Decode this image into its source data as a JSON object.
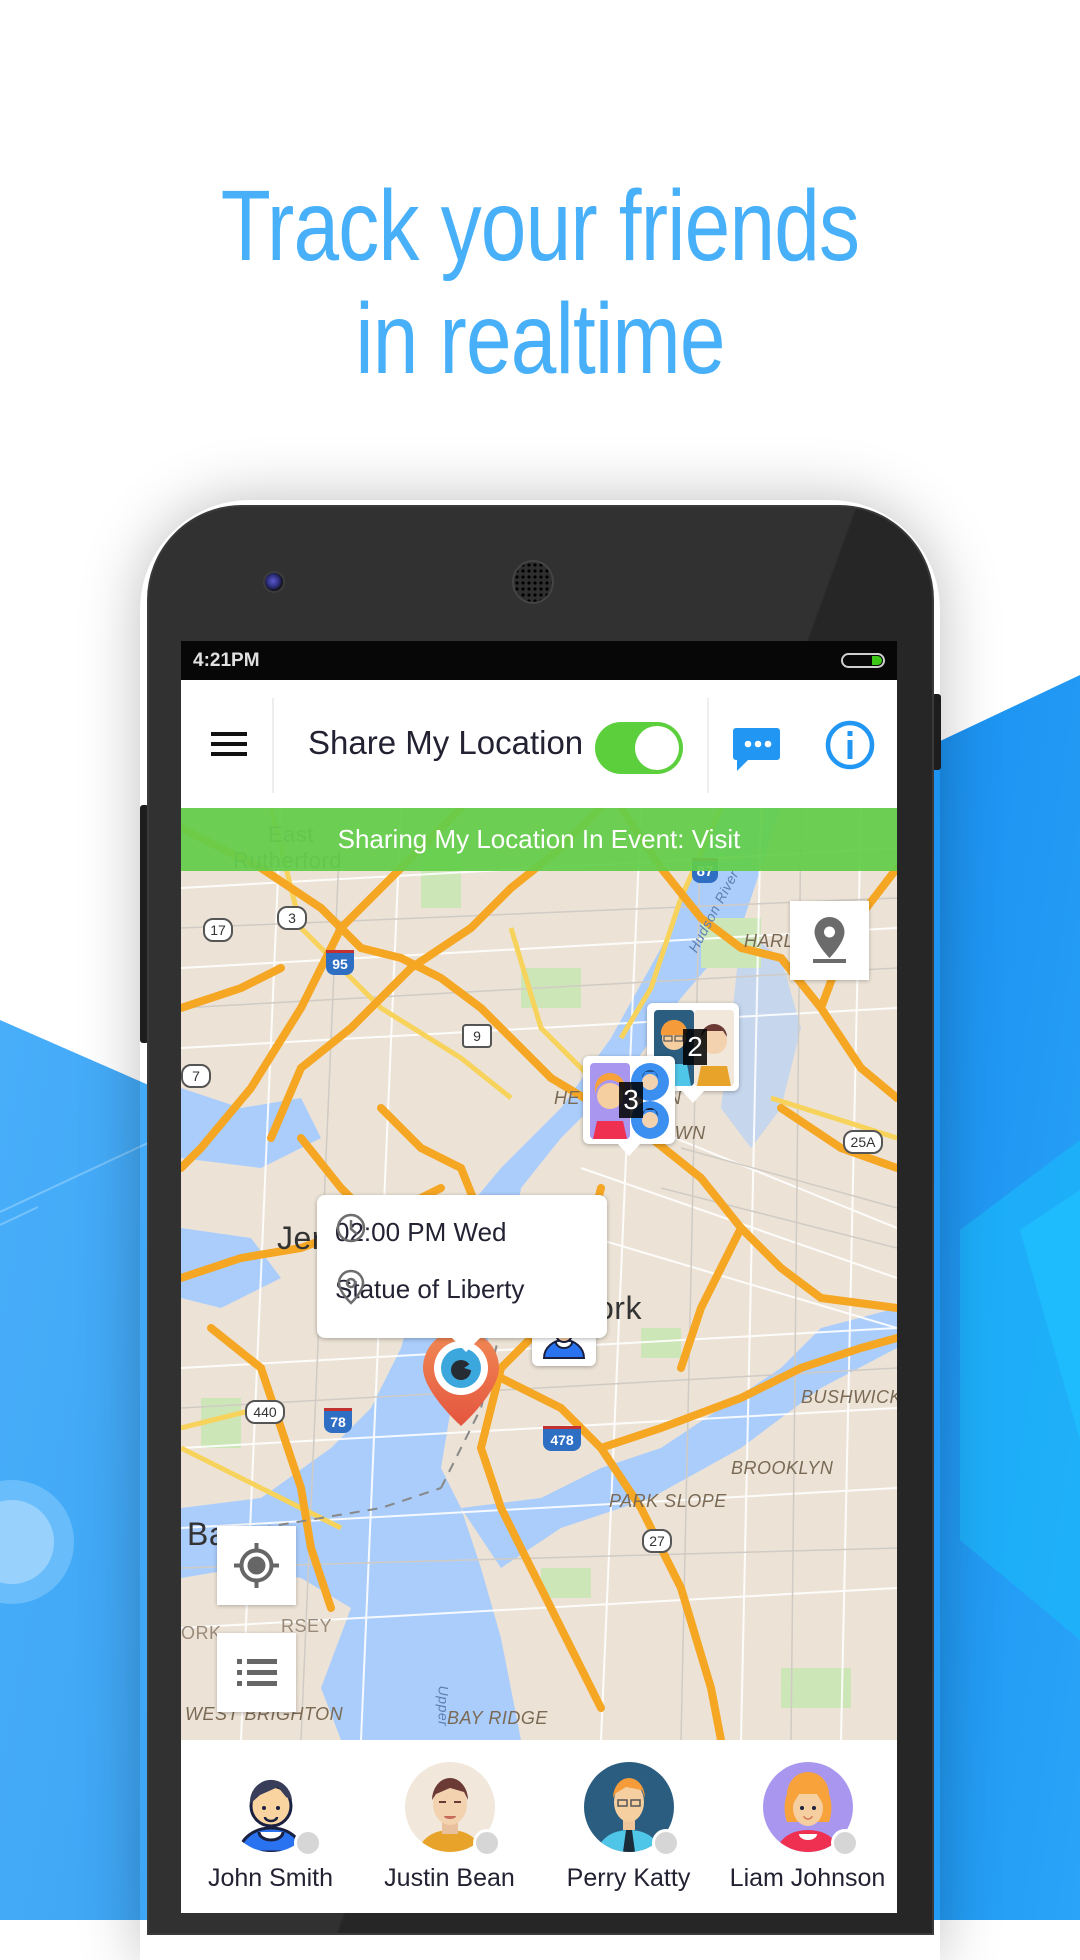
{
  "headline": {
    "line1": "Track your friends",
    "line2": "in realtime"
  },
  "colors": {
    "headline": "#48b0f8",
    "accent_blue": "#2196f3",
    "toggle_on": "#5ccf3c",
    "banner_green": "#62ce4a",
    "map_land": "#ece3d6",
    "map_water": "#abcdfb",
    "highway": "#f5a623"
  },
  "status_bar": {
    "time": "4:21PM",
    "battery_icon": "battery-icon"
  },
  "app_bar": {
    "menu_icon": "hamburger-menu-icon",
    "share_label": "Share My Location",
    "share_toggle_on": true,
    "chat_icon": "chat-bubble-icon",
    "info_icon": "info-icon"
  },
  "banner": {
    "text": "Sharing My Location In Event: Visit"
  },
  "map": {
    "labels": {
      "east_rutherford_1": "East",
      "east_rutherford_2": "Rutherford",
      "harlem": "HARLE",
      "hudson": "Hudson River",
      "hells_kitchen": "HE                N",
      "midtown": "MI    TOWN",
      "jersey": "Jer",
      "newyork_n": "N",
      "newyork_ork": "ork",
      "bushwick": "BUSHWICK",
      "brooklyn": "BROOKLYN",
      "park_slope": "PARK SLOPE",
      "bay_ridge": "BAY RIDGE",
      "west_brighton": "WEST BRIGHTON",
      "bayonne": "Ba",
      "ny_state": "ORK",
      "nj_state": "RSEY",
      "upper_bay": "Upper"
    },
    "shields": [
      "87",
      "17",
      "3",
      "95",
      "9",
      "7",
      "25A",
      "440",
      "78",
      "478",
      "27",
      "3"
    ],
    "event_popup": {
      "time": "02:00 PM Wed",
      "place": "Statue of Liberty"
    },
    "clusters": [
      {
        "count": "2"
      },
      {
        "count": "3"
      }
    ],
    "buttons": {
      "drop_pin": "drop-pin-icon",
      "my_location": "my-location-icon",
      "list": "list-icon"
    }
  },
  "friends": [
    {
      "name": "John Smith",
      "status": "offline"
    },
    {
      "name": "Justin Bean",
      "status": "offline"
    },
    {
      "name": "Perry Katty",
      "status": "offline"
    },
    {
      "name": "Liam Johnson",
      "status": "offline"
    }
  ]
}
